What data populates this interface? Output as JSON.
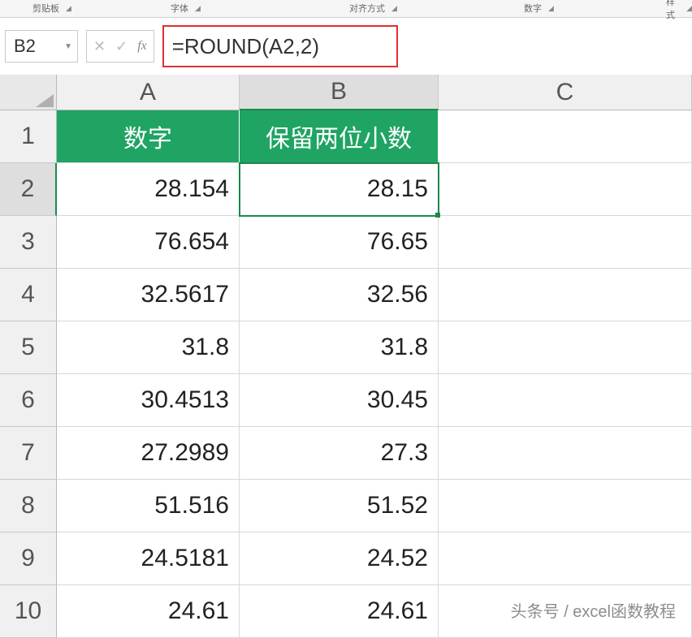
{
  "ribbon": {
    "groups": [
      "剪贴板",
      "字体",
      "对齐方式",
      "数字",
      "样式"
    ],
    "positions": [
      40,
      210,
      430,
      645,
      820
    ]
  },
  "name_box": {
    "value": "B2"
  },
  "formula_bar": {
    "formula": "=ROUND(A2,2)"
  },
  "columns": [
    "A",
    "B",
    "C"
  ],
  "selected_column_index": 1,
  "selected_row": 2,
  "active_cell": "B2",
  "header_row": {
    "a": "数字",
    "b": "保留两位小数"
  },
  "rows": [
    {
      "n": 1,
      "a": "数字",
      "b": "保留两位小数",
      "header": true
    },
    {
      "n": 2,
      "a": "28.154",
      "b": "28.15"
    },
    {
      "n": 3,
      "a": "76.654",
      "b": "76.65"
    },
    {
      "n": 4,
      "a": "32.5617",
      "b": "32.56"
    },
    {
      "n": 5,
      "a": "31.8",
      "b": "31.8"
    },
    {
      "n": 6,
      "a": "30.4513",
      "b": "30.45"
    },
    {
      "n": 7,
      "a": "27.2989",
      "b": "27.3"
    },
    {
      "n": 8,
      "a": "51.516",
      "b": "51.52"
    },
    {
      "n": 9,
      "a": "24.5181",
      "b": "24.52"
    },
    {
      "n": 10,
      "a": "24.61",
      "b": "24.61"
    }
  ],
  "watermark": "头条号 / excel函数教程"
}
